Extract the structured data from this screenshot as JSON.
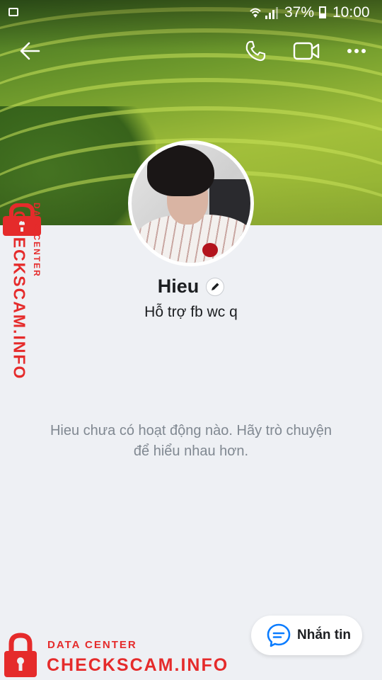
{
  "status_bar": {
    "battery_percent": "37%",
    "time": "10:00"
  },
  "header": {
    "icons": [
      "back-arrow-icon",
      "phone-call-icon",
      "video-call-icon",
      "more-options-icon"
    ]
  },
  "profile": {
    "name": "Hieu",
    "subtitle": "Hỗ trợ fb wc q"
  },
  "activity": {
    "empty_message": "Hieu chưa có hoạt động nào. Hãy trò chuyện để hiểu nhau hơn."
  },
  "message_button": {
    "label": "Nhắn tin"
  },
  "watermark": {
    "line1": "DATA CENTER",
    "line2": "CHECKSCAM.INFO"
  },
  "colors": {
    "accent_blue": "#0a7cff",
    "watermark_red": "#e52b2b",
    "background": "#eef0f4"
  }
}
